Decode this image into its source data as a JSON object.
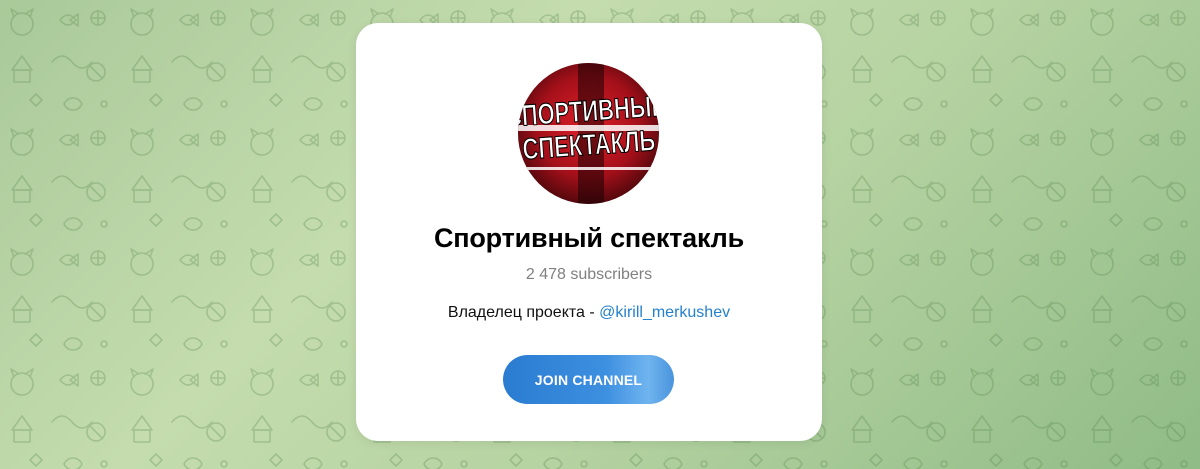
{
  "channel": {
    "title": "Спортивный спектакль",
    "subscribers": "2 478 subscribers",
    "description_prefix": "Владелец проекта - ",
    "description_mention": "@kirill_merkushev",
    "avatar_text_line1": "СПОРТИВНЫЙ",
    "avatar_text_line2": "СПЕКТАКЛЬ"
  },
  "actions": {
    "join_label": "JOIN CHANNEL"
  },
  "colors": {
    "accent": "#2481cc",
    "background": "#b6d3a2",
    "card": "#ffffff"
  },
  "icons": {
    "background": "doodle-pattern",
    "avatar": "channel-avatar"
  }
}
